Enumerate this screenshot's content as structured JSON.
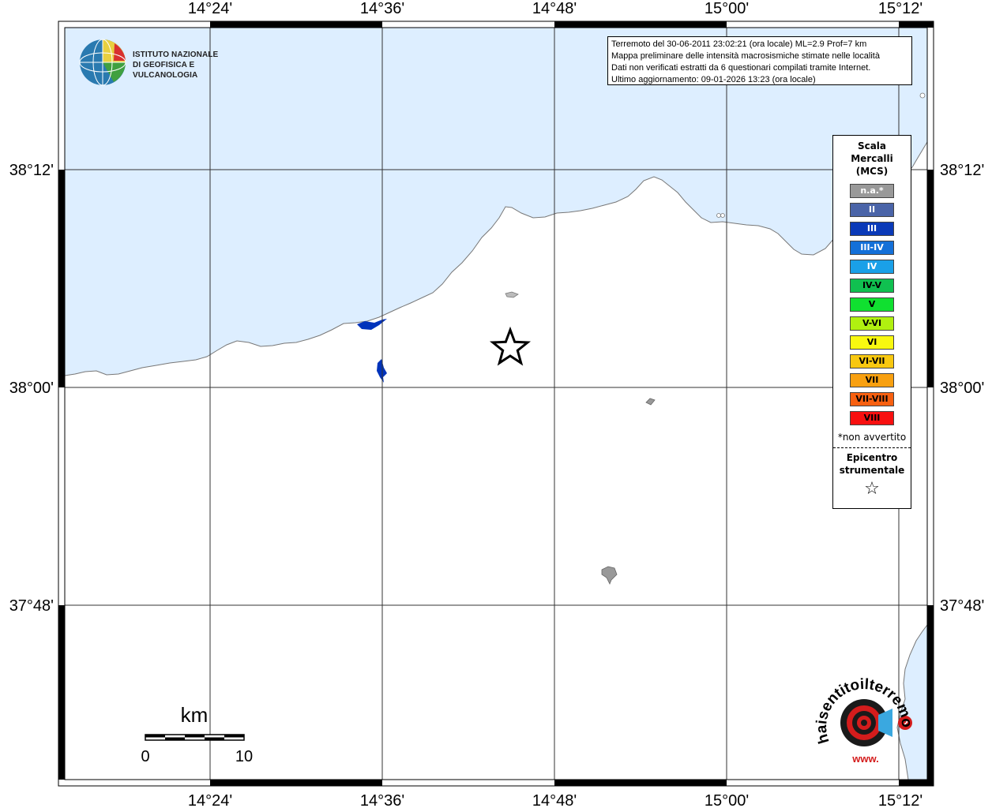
{
  "map": {
    "lon_labels_top": [
      "14°24'",
      "14°36'",
      "14°48'",
      "15°00'",
      "15°12'"
    ],
    "lon_labels_bottom": [
      "14°24'",
      "14°36'",
      "14°48'",
      "15°00'",
      "15°12'"
    ],
    "lat_labels_left": [
      "38°12'",
      "38°00'",
      "37°48'"
    ],
    "lat_labels_right": [
      "38°12'",
      "38°00'",
      "37°48'"
    ],
    "colors": {
      "sea": "#ddeeff",
      "land": "#ffffff",
      "coast": "#777777",
      "grid": "#333333",
      "lake": "#0033bb"
    }
  },
  "info": {
    "line1": "Terremoto del 30-06-2011 23:02:21 (ora locale) ML=2.9 Prof=7 km",
    "line2": "Mappa preliminare delle intensità macrosismiche stimate nelle località",
    "line3": "Dati non verificati estratti da 6 questionari compilati tramite Internet.",
    "line4": "Ultimo aggiornamento: 09-01-2026 13:23 (ora locale)"
  },
  "institute": {
    "line1": "ISTITUTO NAZIONALE",
    "line2": "DI GEOFISICA E VULCANOLOGIA"
  },
  "legend": {
    "title1": "Scala",
    "title2": "Mercalli",
    "title3": "(MCS)",
    "items": [
      {
        "label": "n.a.*",
        "color": "#999999",
        "text_color": "#ffffff"
      },
      {
        "label": "II",
        "color": "#4a64a8",
        "text_color": "#ffffff"
      },
      {
        "label": "III",
        "color": "#0a3ab8",
        "text_color": "#ffffff"
      },
      {
        "label": "III-IV",
        "color": "#1470d8",
        "text_color": "#ffffff"
      },
      {
        "label": "IV",
        "color": "#1aa0e8",
        "text_color": "#ffffff"
      },
      {
        "label": "IV-V",
        "color": "#10c050",
        "text_color": "#000000"
      },
      {
        "label": "V",
        "color": "#10e030",
        "text_color": "#000000"
      },
      {
        "label": "V-VI",
        "color": "#b0f010",
        "text_color": "#000000"
      },
      {
        "label": "VI",
        "color": "#f8f810",
        "text_color": "#000000"
      },
      {
        "label": "VI-VII",
        "color": "#f8c810",
        "text_color": "#000000"
      },
      {
        "label": "VII",
        "color": "#f8a010",
        "text_color": "#000000"
      },
      {
        "label": "VII-VIII",
        "color": "#f86010",
        "text_color": "#000000"
      },
      {
        "label": "VIII",
        "color": "#f81010",
        "text_color": "#000000"
      }
    ],
    "note": "*non avvertito",
    "epicentre1": "Epicentro",
    "epicentre2": "strumentale",
    "star_symbol": "☆"
  },
  "scale_bar": {
    "unit": "km",
    "label_start": "0",
    "label_end": "10"
  },
  "site_logo": {
    "text": "haisentitoilterremoto.it",
    "prefix": "www."
  }
}
